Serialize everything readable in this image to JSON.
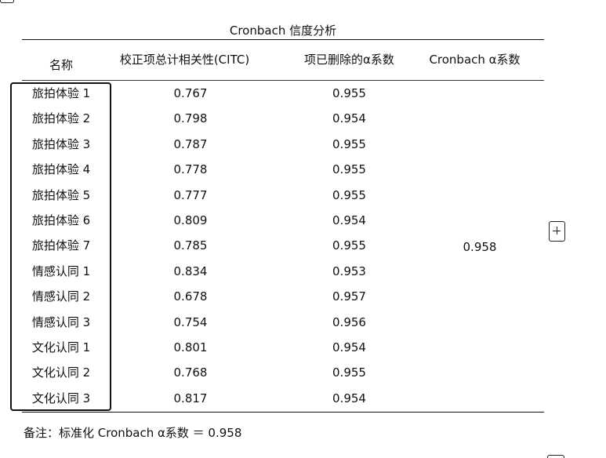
{
  "table": {
    "title": "Cronbach 信度分析",
    "headers": {
      "name": "名称",
      "citc": "校正项总计相关性(CITC)",
      "deleted": "项已删除的α系数",
      "alpha": "Cronbach α系数"
    },
    "rows": [
      {
        "name": "旅拍体验 1",
        "citc": "0.767",
        "deleted": "0.955"
      },
      {
        "name": "旅拍体验 2",
        "citc": "0.798",
        "deleted": "0.954"
      },
      {
        "name": "旅拍体验 3",
        "citc": "0.787",
        "deleted": "0.955"
      },
      {
        "name": "旅拍体验 4",
        "citc": "0.778",
        "deleted": "0.955"
      },
      {
        "name": "旅拍体验 5",
        "citc": "0.777",
        "deleted": "0.955"
      },
      {
        "name": "旅拍体验 6",
        "citc": "0.809",
        "deleted": "0.954"
      },
      {
        "name": "旅拍体验 7",
        "citc": "0.785",
        "deleted": "0.955"
      },
      {
        "name": "情感认同 1",
        "citc": "0.834",
        "deleted": "0.953"
      },
      {
        "name": "情感认同 2",
        "citc": "0.678",
        "deleted": "0.957"
      },
      {
        "name": "情感认同 3",
        "citc": "0.754",
        "deleted": "0.956"
      },
      {
        "name": "文化认同 1",
        "citc": "0.801",
        "deleted": "0.954"
      },
      {
        "name": "文化认同 2",
        "citc": "0.768",
        "deleted": "0.955"
      },
      {
        "name": "文化认同 3",
        "citc": "0.817",
        "deleted": "0.954"
      }
    ],
    "alpha_value": "0.958"
  },
  "note": "备注：标准化 Cronbach  α系数 ＝ 0.958",
  "icons": {
    "expand": "plus-icon"
  }
}
